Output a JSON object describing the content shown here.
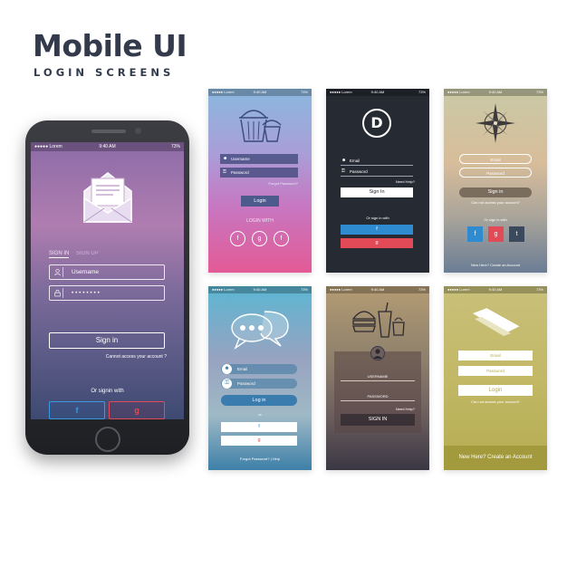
{
  "header": {
    "title": "Mobile UI",
    "subtitle": "LOGIN SCREENS"
  },
  "main_phone": {
    "status": {
      "carrier": "●●●●● Lorem",
      "time": "9:40 AM",
      "battery": "73%"
    },
    "tabs": {
      "signin": "SIGN IN",
      "signup": "SIGN UP"
    },
    "username_placeholder": "Username",
    "password_value": "• • • • • • • •",
    "signin_label": "Sign in",
    "forgot": "Cannot access your account ?",
    "or_signin": "Or signin with",
    "facebook": "f",
    "google": "g"
  },
  "screens": {
    "s1": {
      "carrier": "●●●●● Lorem",
      "time": "9:40 AM",
      "battery": "73%",
      "username": "Username",
      "password": "Password",
      "forgot": "Forgot Password?",
      "login": "Login",
      "login_with": "LOGIN WITH",
      "f": "f",
      "g": "g",
      "t": "t"
    },
    "s2": {
      "carrier": "●●●●● Lorem",
      "time": "9:40 AM",
      "battery": "73%",
      "logo": "D",
      "email": "Email",
      "password": "Password",
      "need_help": "Need Help?",
      "sign_in": "Sign In",
      "or_signin": "Or sign in with",
      "f": "f",
      "g": "g"
    },
    "s3": {
      "carrier": "●●●●● Lorem",
      "time": "9:40 AM",
      "battery": "73%",
      "email": "Email",
      "password": "Password",
      "sign_in": "Sign in",
      "cant_access": "Can not access your account?",
      "or_signin": "Or sign in with",
      "f": "f",
      "g": "g",
      "t": "t",
      "new_here": "New Here? Create an Account"
    },
    "s4": {
      "carrier": "●●●●● Lorem",
      "time": "9:40 AM",
      "battery": "73%",
      "email": "Email",
      "password": "Password",
      "login": "Log in",
      "or": "or",
      "f": "f",
      "g": "g",
      "forgot": "Forgot Password?  |  Help"
    },
    "s5": {
      "carrier": "●●●●● Lorem",
      "time": "9:40 AM",
      "battery": "73%",
      "username": "USERNAME",
      "password": "PASSWORD",
      "need_help": "Need Help?",
      "sign_in": "SIGN IN"
    },
    "s6": {
      "carrier": "●●●●● Lorem",
      "time": "9:40 AM",
      "battery": "73%",
      "email": "Email",
      "password": "Password",
      "login": "Login",
      "cant_access": "Can not access your account?",
      "new_here": "New Here? Create an Account"
    }
  },
  "colors": {
    "facebook": "#2e8bd0",
    "google": "#e34a57",
    "tumblr": "#3a4a5c"
  }
}
